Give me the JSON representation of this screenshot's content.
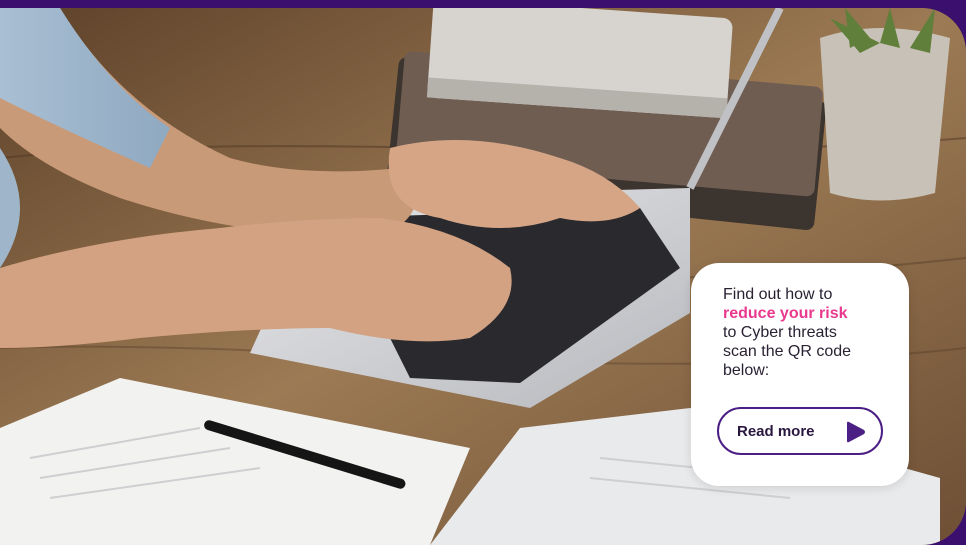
{
  "card": {
    "line1": "Find out how to",
    "highlight": "reduce your risk",
    "line3": "to Cyber threats",
    "line4": "scan the QR code",
    "line5": "below:",
    "button_label": "Read more"
  },
  "colors": {
    "frame_border": "#3a0f6e",
    "accent": "#e8398e",
    "button_border": "#4b1f84",
    "play_icon": "#4b1f84"
  },
  "icons": {
    "button_icon": "play-icon"
  }
}
